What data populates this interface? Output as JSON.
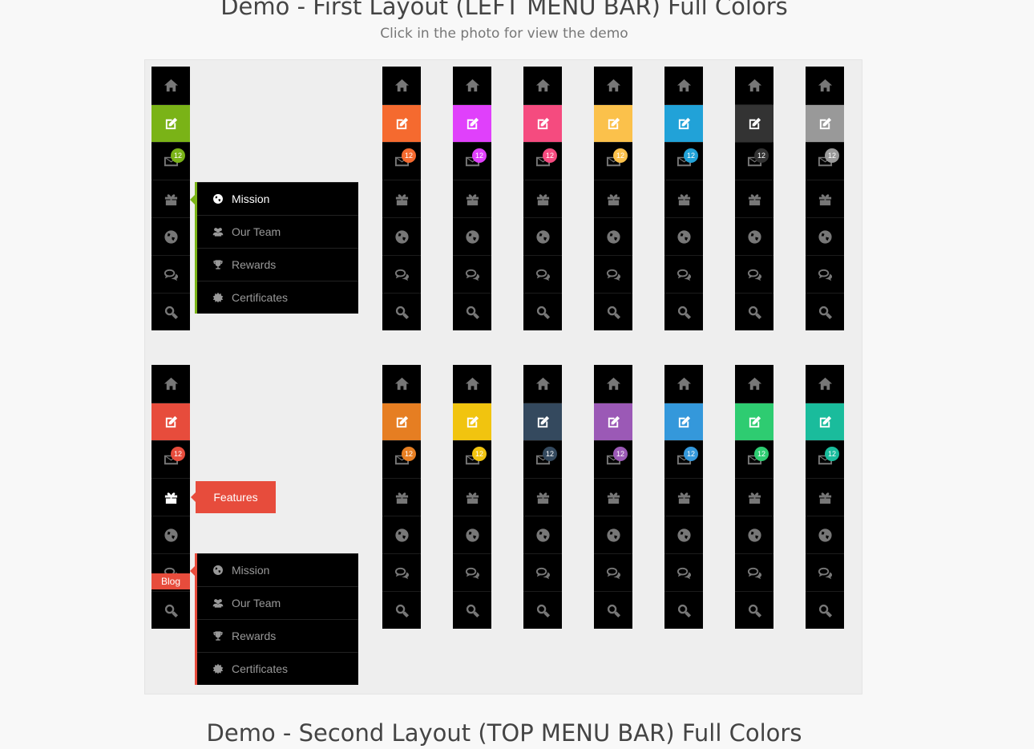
{
  "header": {
    "title": "Demo - First Layout (LEFT MENU BAR) Full Colors",
    "subtitle": "Click in the photo for view the demo"
  },
  "footer": {
    "title": "Demo - Second Layout (TOP MENU BAR) Full Colors"
  },
  "badge_count": "12",
  "icons": [
    "home-icon",
    "edit-icon",
    "mail-icon",
    "gift-icon",
    "globe-icon",
    "comments-icon",
    "search-icon"
  ],
  "row1_colors": [
    "#7ab317",
    "#f56a2f",
    "#e040fb",
    "#f54b7f",
    "#fbc14b",
    "#21a2d8",
    "#333333",
    "#999999"
  ],
  "row2_colors": [
    "#e74c3c",
    "#e67e22",
    "#f1c40f",
    "#34495e",
    "#9b59b6",
    "#3498db",
    "#2ecc71",
    "#1abc9c"
  ],
  "submenu_top": {
    "items": [
      {
        "label": "Mission",
        "icon": "globe-icon"
      },
      {
        "label": "Our Team",
        "icon": "users-icon"
      },
      {
        "label": "Rewards",
        "icon": "trophy-icon"
      },
      {
        "label": "Certificates",
        "icon": "certificate-icon"
      }
    ]
  },
  "submenu_bottom": {
    "items": [
      {
        "label": "Mission",
        "icon": "globe-icon"
      },
      {
        "label": "Our Team",
        "icon": "users-icon"
      },
      {
        "label": "Rewards",
        "icon": "trophy-icon"
      },
      {
        "label": "Certificates",
        "icon": "certificate-icon"
      }
    ]
  },
  "tooltip_features": "Features",
  "label_blog": "Blog"
}
